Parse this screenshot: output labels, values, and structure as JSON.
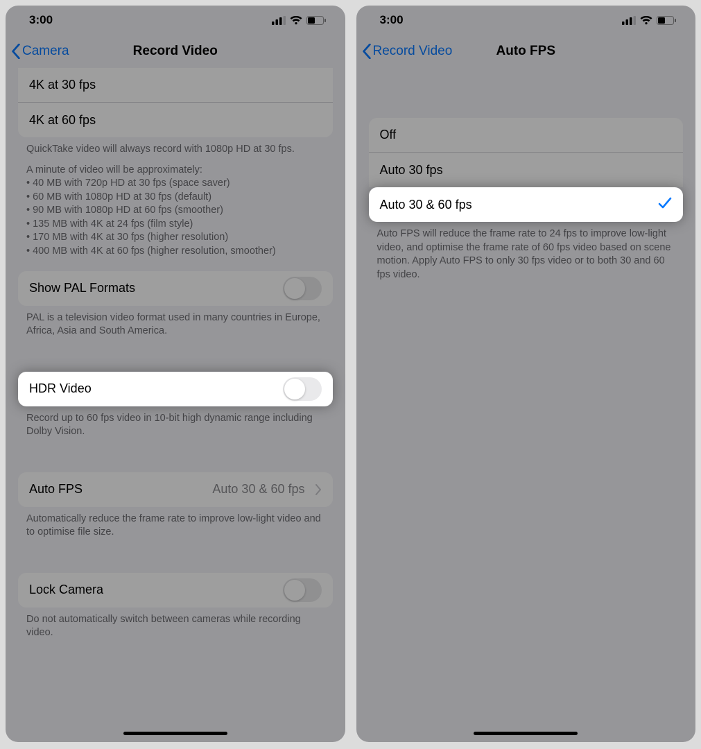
{
  "status": {
    "time": "3:00"
  },
  "left": {
    "back_label": "Camera",
    "title": "Record Video",
    "options": {
      "r4k30": "4K at 30 fps",
      "r4k60": "4K at 60 fps"
    },
    "footer1_line1": "QuickTake video will always record with 1080p HD at 30 fps.",
    "footer1_lead": "A minute of video will be approximately:",
    "footer1_b1": "• 40 MB with 720p HD at 30 fps (space saver)",
    "footer1_b2": "• 60 MB with 1080p HD at 30 fps (default)",
    "footer1_b3": "• 90 MB with 1080p HD at 60 fps (smoother)",
    "footer1_b4": "• 135 MB with 4K at 24 fps (film style)",
    "footer1_b5": "• 170 MB with 4K at 30 fps (higher resolution)",
    "footer1_b6": "• 400 MB with 4K at 60 fps (higher resolution, smoother)",
    "pal_label": "Show PAL Formats",
    "pal_footer": "PAL is a television video format used in many countries in Europe, Africa, Asia and South America.",
    "hdr_label": "HDR Video",
    "hdr_footer": "Record up to 60 fps video in 10-bit high dynamic range including Dolby Vision.",
    "autofps_label": "Auto FPS",
    "autofps_value": "Auto 30 & 60 fps",
    "autofps_footer": "Automatically reduce the frame rate to improve low-light video and to optimise file size.",
    "lock_label": "Lock Camera",
    "lock_footer": "Do not automatically switch between cameras while recording video."
  },
  "right": {
    "back_label": "Record Video",
    "title": "Auto FPS",
    "opt_off": "Off",
    "opt_30": "Auto 30 fps",
    "opt_3060": "Auto 30 & 60 fps",
    "footer": "Auto FPS will reduce the frame rate to 24 fps to improve low-light video, and optimise the frame rate of 60 fps video based on scene motion. Apply Auto FPS to only 30 fps video or to both 30 and 60 fps video."
  }
}
